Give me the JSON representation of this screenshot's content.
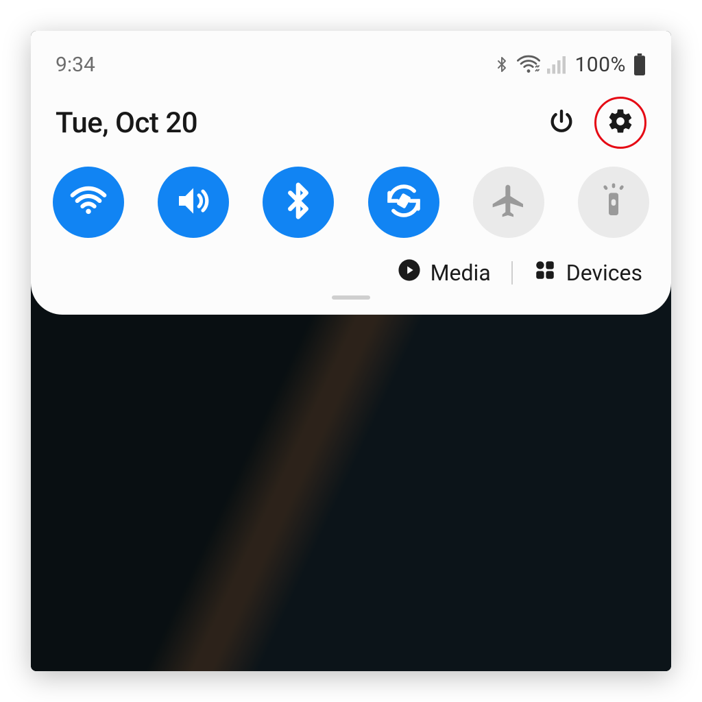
{
  "status": {
    "time": "9:34",
    "battery_pct": "100%"
  },
  "header": {
    "date": "Tue, Oct 20"
  },
  "toggles": [
    {
      "name": "wifi",
      "on": true
    },
    {
      "name": "sound",
      "on": true
    },
    {
      "name": "bluetooth",
      "on": true
    },
    {
      "name": "auto-rotate",
      "on": true
    },
    {
      "name": "airplane",
      "on": false
    },
    {
      "name": "flashlight",
      "on": false
    }
  ],
  "lower": {
    "media_label": "Media",
    "devices_label": "Devices"
  },
  "colors": {
    "toggle_on": "#1184f3",
    "toggle_off": "#eaeaea",
    "highlight": "#e50914"
  }
}
